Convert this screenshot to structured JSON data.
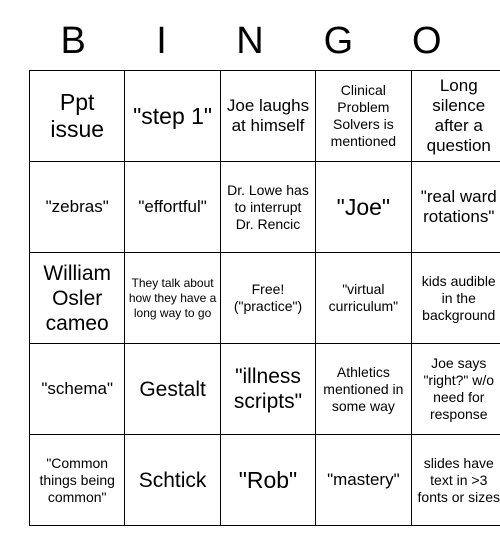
{
  "card": {
    "header_letters": [
      "B",
      "I",
      "N",
      "G",
      "O"
    ],
    "rows": [
      [
        {
          "text": "Ppt issue",
          "size": "t-xl"
        },
        {
          "text": "\"step 1\"",
          "size": "t-xl"
        },
        {
          "text": "Joe laughs at himself",
          "size": "t-md"
        },
        {
          "text": "Clinical Problem Solvers is mentioned",
          "size": "t-sm"
        },
        {
          "text": "Long silence after a question",
          "size": "t-md"
        }
      ],
      [
        {
          "text": "\"zebras\"",
          "size": "t-md"
        },
        {
          "text": "\"effortful\"",
          "size": "t-md"
        },
        {
          "text": "Dr. Lowe has to interrupt Dr. Rencic",
          "size": "t-sm"
        },
        {
          "text": "\"Joe\"",
          "size": "t-xl"
        },
        {
          "text": "\"real ward rotations\"",
          "size": "t-md"
        }
      ],
      [
        {
          "text": "William Osler cameo",
          "size": "t-lg"
        },
        {
          "text": "They talk about how they have a long way to go",
          "size": "t-xs"
        },
        {
          "text": "Free! (\"practice\")",
          "size": "t-sm"
        },
        {
          "text": "\"virtual curriculum\"",
          "size": "t-sm"
        },
        {
          "text": "kids audible in the background",
          "size": "t-sm"
        }
      ],
      [
        {
          "text": "\"schema\"",
          "size": "t-md"
        },
        {
          "text": "Gestalt",
          "size": "t-lg"
        },
        {
          "text": "\"illness scripts\"",
          "size": "t-lg"
        },
        {
          "text": "Athletics mentioned in some way",
          "size": "t-sm"
        },
        {
          "text": "Joe says \"right?\" w/o need for response",
          "size": "t-sm"
        }
      ],
      [
        {
          "text": "\"Common things being common\"",
          "size": "t-sm"
        },
        {
          "text": "Schtick",
          "size": "t-lg"
        },
        {
          "text": "\"Rob\"",
          "size": "t-xl"
        },
        {
          "text": "\"mastery\"",
          "size": "t-md"
        },
        {
          "text": "slides have text in >3 fonts or sizes",
          "size": "t-sm"
        }
      ]
    ]
  },
  "colors": {
    "background": "#ffffff",
    "text": "#000000",
    "border": "#000000"
  }
}
